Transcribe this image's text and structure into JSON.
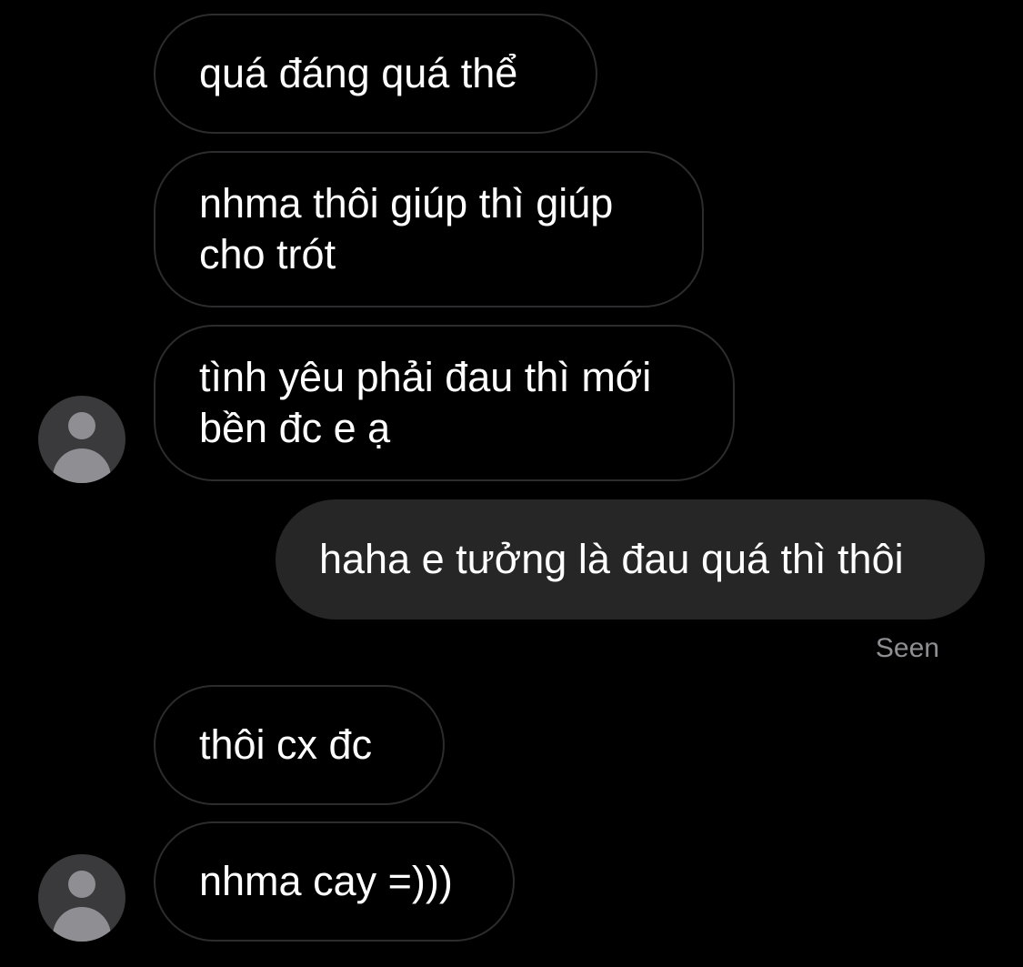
{
  "thread": {
    "messages": [
      {
        "direction": "received",
        "text": "quá đáng quá thể"
      },
      {
        "direction": "received",
        "text": "nhma thôi giúp thì giúp cho trót"
      },
      {
        "direction": "received",
        "text": "tình yêu phải đau thì mới bền đc e ạ"
      },
      {
        "direction": "sent",
        "text": "haha e tưởng là đau quá thì thôi"
      },
      {
        "direction": "received",
        "text": "thôi cx đc"
      },
      {
        "direction": "received",
        "text": "nhma cay =)))"
      }
    ],
    "receipt": "Seen"
  },
  "icons": {
    "avatar": "default-user-avatar-icon"
  },
  "colors": {
    "background": "#000000",
    "received_bubble_border": "#2c2c2e",
    "sent_bubble_fill": "#262626",
    "avatar_fill": "#3a3a3c",
    "avatar_glyph": "#8e8e93",
    "seen_text": "#8e8e93"
  }
}
